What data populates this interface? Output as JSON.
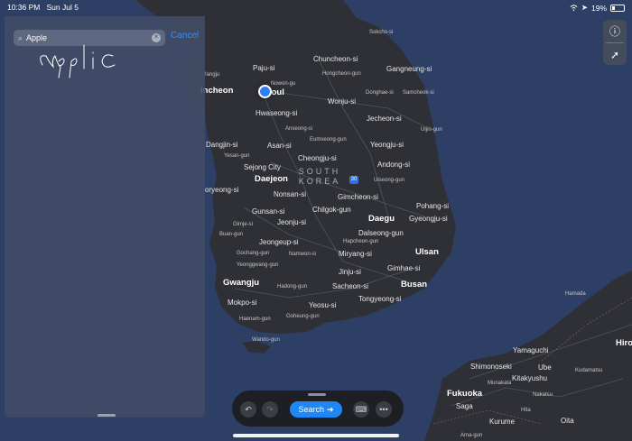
{
  "status_bar": {
    "time": "10:36 PM",
    "date": "Sun Jul 5",
    "battery": "19%"
  },
  "search": {
    "value": "Apple",
    "cancel_label": "Cancel"
  },
  "hw_toolbar": {
    "search_label": "Search"
  },
  "icons": {
    "info": "info-icon",
    "location": "location-arrow-icon",
    "undo": "undo-icon",
    "redo": "redo-icon",
    "keyboard": "keyboard-icon",
    "more": "more-icon"
  },
  "map": {
    "country": "SOUTH KOREA",
    "route_shield": "30",
    "big_labels": [
      "Seoul",
      "Incheon",
      "Daegu",
      "Ulsan",
      "Busan",
      "Gwangju",
      "Fukuoka",
      "Hiro"
    ],
    "labels": [
      "Sokcho-si",
      "Paju-si",
      "Chuncheon-si",
      "Hongcheon-gun",
      "Gangneung-si",
      "Nowon-gu",
      "Donghae-si",
      "Samcheok-si",
      "Wonju-si",
      "Hwaseong-si",
      "Jecheon-si",
      "Uljin-gun",
      "Anseong-si",
      "Dangjin-si",
      "Asan-si",
      "Eumseong-gun",
      "Yeongju-si",
      "Yesan-gun",
      "Sejong City",
      "Cheongju-si",
      "Andong-si",
      "Daejeon",
      "Uiseong-gun",
      "oryeong-si",
      "Nonsan-si",
      "Gimcheon-si",
      "Pohang-si",
      "Gunsan-si",
      "Chilgok-gun",
      "Gimje-si",
      "Jeonju-si",
      "Gyeongju-si",
      "Buan-gun",
      "Dalseong-gun",
      "Jeongeup-si",
      "Hapcheon-gun",
      "Gochang-gun",
      "Namwon-si",
      "Miryang-si",
      "Yeonggwang-gun",
      "Gimhae-si",
      "Jinju-si",
      "Hadong-gun",
      "Sacheon-si",
      "Tongyeong-si",
      "Mokpo-si",
      "Yeosu-si",
      "Haenam-gun",
      "Goheung-gun",
      "Wando-gun",
      "Hamada",
      "Yamaguchi",
      "Shimonoseki",
      "Ube",
      "Kitakyushu",
      "Kudamatsu",
      "Munakata",
      "Nakatsu",
      "Saga",
      "Kurume",
      "Oita",
      "Hita",
      "Ama-gun",
      "Yangju"
    ]
  }
}
